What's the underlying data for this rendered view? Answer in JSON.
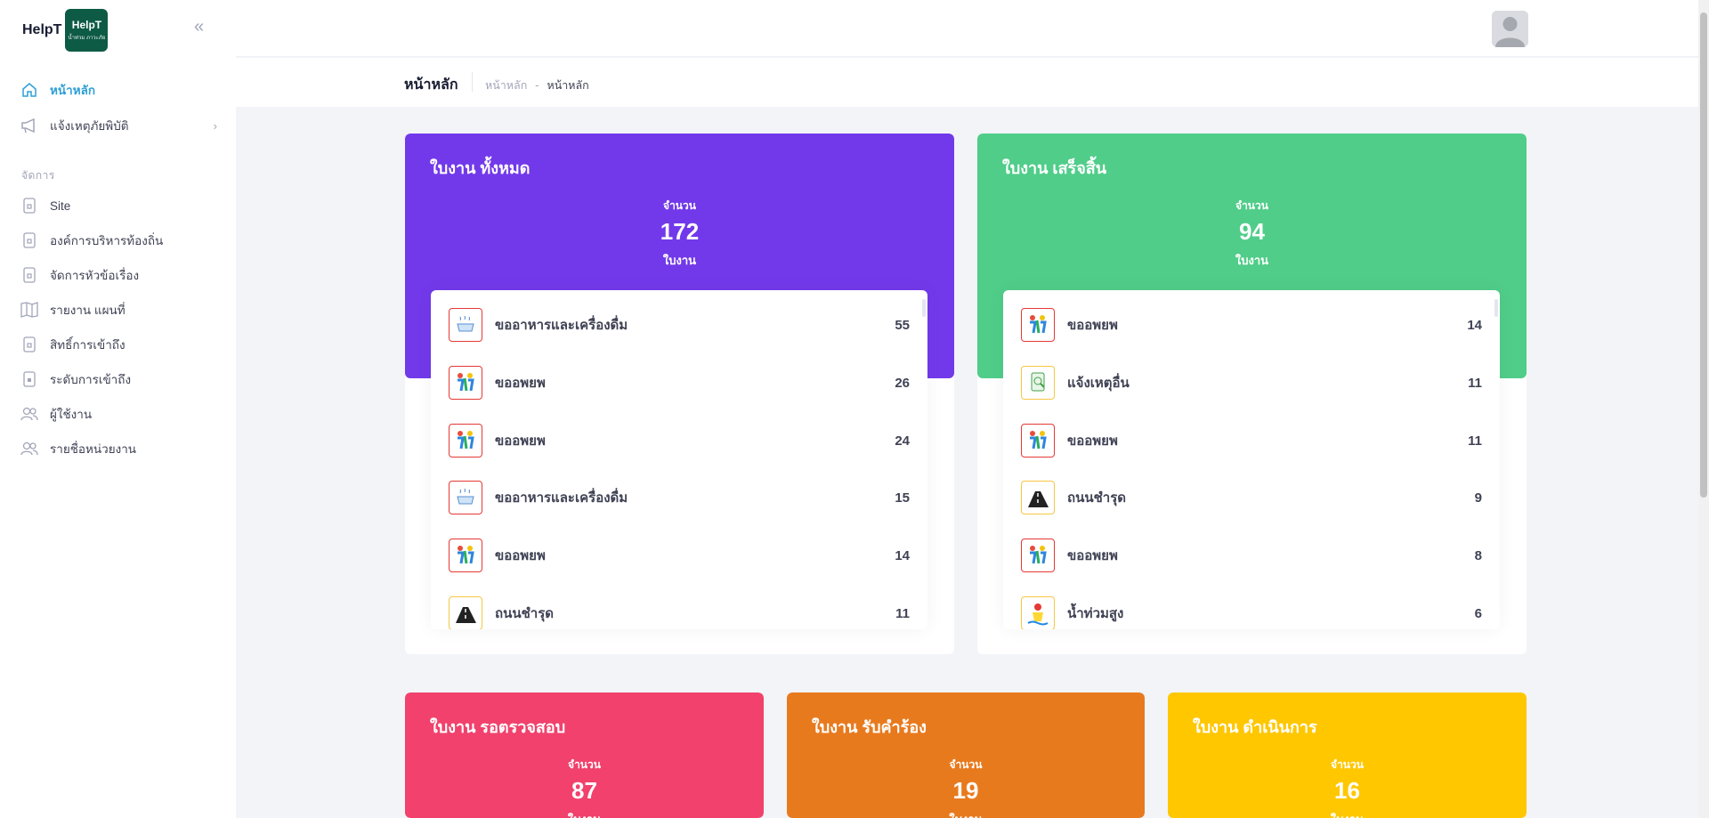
{
  "brand": {
    "name": "HelpT",
    "logo_text": "HelpT",
    "logo_subtext": "น้ำท่วม ภาวะภัย"
  },
  "sidebar": {
    "items": [
      {
        "label": "หน้าหลัก",
        "icon": "home-icon"
      },
      {
        "label": "แจ้งเหตุภัยพิบัติ",
        "icon": "megaphone-icon"
      }
    ],
    "section_title": "จัดการ",
    "manage_items": [
      {
        "label": "Site",
        "icon": "lock-icon"
      },
      {
        "label": "องค์การบริหารท้องถิ่น",
        "icon": "lock-icon"
      },
      {
        "label": "จัดการหัวข้อเรื่อง",
        "icon": "lock-icon"
      },
      {
        "label": "รายงาน แผนที่",
        "icon": "map-icon"
      },
      {
        "label": "สิทธิ์การเข้าถึง",
        "icon": "lock-icon"
      },
      {
        "label": "ระดับการเข้าถึง",
        "icon": "lock-icon"
      },
      {
        "label": "ผู้ใช้งาน",
        "icon": "users-icon"
      },
      {
        "label": "รายชื่อหน่วยงาน",
        "icon": "users-icon"
      }
    ]
  },
  "toolbar": {
    "page_title": "หน้าหลัก",
    "breadcrumb": [
      "หน้าหลัก",
      "หน้าหลัก"
    ]
  },
  "cards": {
    "total": {
      "title": "ใบงาน ทั้งหมด",
      "count_label": "จำนวน",
      "count": "172",
      "unit": "ใบงาน",
      "color": "#7239ea",
      "items": [
        {
          "name": "ขออาหารและเครื่องดื่ม",
          "value": "55",
          "icon": "food-icon"
        },
        {
          "name": "ขออพยพ",
          "value": "26",
          "icon": "evacuate-icon"
        },
        {
          "name": "ขออพยพ",
          "value": "24",
          "icon": "evacuate-icon"
        },
        {
          "name": "ขออาหารและเครื่องดื่ม",
          "value": "15",
          "icon": "food-icon"
        },
        {
          "name": "ขออพยพ",
          "value": "14",
          "icon": "evacuate-icon"
        },
        {
          "name": "ถนนชำรุด",
          "value": "11",
          "icon": "road-icon"
        }
      ]
    },
    "done": {
      "title": "ใบงาน เสร็จสิ้น",
      "count_label": "จำนวน",
      "count": "94",
      "unit": "ใบงาน",
      "color": "#50cd89",
      "items": [
        {
          "name": "ขออพยพ",
          "value": "14",
          "icon": "evacuate-icon"
        },
        {
          "name": "แจ้งเหตุอื่น",
          "value": "11",
          "icon": "report-icon"
        },
        {
          "name": "ขออพยพ",
          "value": "11",
          "icon": "evacuate-icon"
        },
        {
          "name": "ถนนชำรุด",
          "value": "9",
          "icon": "road-icon"
        },
        {
          "name": "ขออพยพ",
          "value": "8",
          "icon": "evacuate-icon"
        },
        {
          "name": "น้ำท่วมสูง",
          "value": "6",
          "icon": "flood-icon"
        }
      ]
    },
    "review": {
      "title": "ใบงาน รอตรวจสอบ",
      "count_label": "จำนวน",
      "count": "87",
      "unit": "ใบงาน",
      "color": "#f1416c"
    },
    "accepted": {
      "title": "ใบงาน รับคำร้อง",
      "count_label": "จำนวน",
      "count": "19",
      "unit": "ใบงาน",
      "color": "#e87a1e"
    },
    "progress": {
      "title": "ใบงาน ดำเนินการ",
      "count_label": "จำนวน",
      "count": "16",
      "unit": "ใบงาน",
      "color": "#ffc700"
    }
  }
}
